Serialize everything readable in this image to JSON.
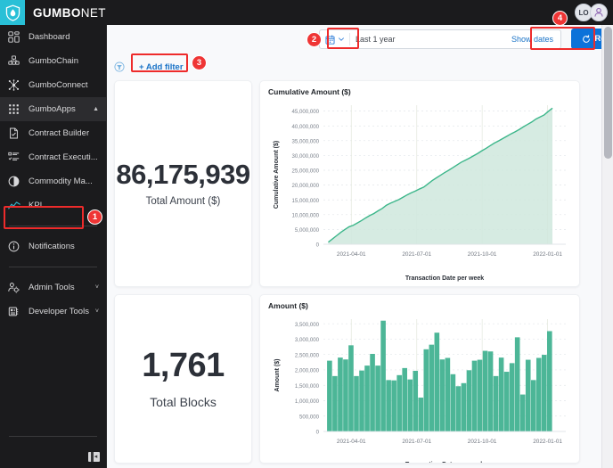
{
  "brand": {
    "bold": "GUMBO",
    "light": "NET",
    "logo_icon": "droplet-shield-logo"
  },
  "account": {
    "avatar1_initials": "LO",
    "avatar2_icon": "user-profile-icon"
  },
  "sidebar": {
    "items": [
      {
        "label": "Dashboard",
        "icon": "dashboard-grid-icon",
        "active": false,
        "chevron": ""
      },
      {
        "label": "GumboChain",
        "icon": "chain-blocks-icon",
        "active": false,
        "chevron": ""
      },
      {
        "label": "GumboConnect",
        "icon": "network-nodes-icon",
        "active": false,
        "chevron": ""
      },
      {
        "label": "GumboApps",
        "icon": "apps-dots-icon",
        "active": true,
        "chevron": "▲"
      },
      {
        "label": "Contract Builder",
        "icon": "document-check-icon",
        "active": false,
        "chevron": ""
      },
      {
        "label": "Contract Executi...",
        "icon": "checklist-icon",
        "active": false,
        "chevron": ""
      },
      {
        "label": "Commodity Ma...",
        "icon": "contrast-circle-icon",
        "active": false,
        "chevron": ""
      },
      {
        "label": "KPI",
        "icon": "trend-line-icon",
        "active": false,
        "chevron": ""
      }
    ],
    "items_after_sep": [
      {
        "label": "Notifications",
        "icon": "info-circle-icon",
        "chevron": ""
      }
    ],
    "items_footer": [
      {
        "label": "Admin Tools",
        "icon": "admin-gear-user-icon",
        "chevron": "˅"
      },
      {
        "label": "Developer Tools",
        "icon": "developer-chip-icon",
        "chevron": "˅"
      }
    ],
    "collapse_button": "collapse-sidebar-icon"
  },
  "toolbar": {
    "calendar_icon": "calendar-icon",
    "dropdown_icon": "chevron-down-icon",
    "date_range_value": "Last 1 year",
    "date_range_placeholder": "Last 1 year",
    "show_dates_label": "Show dates",
    "refresh_label": "Refresh",
    "refresh_icon": "refresh-icon",
    "refresh_color": "#0b72d9"
  },
  "filters": {
    "filter_icon": "funnel-icon",
    "add_filter_label": "+ Add filter"
  },
  "kpis": [
    {
      "value": "86,175,939",
      "label": "Total Amount ($)"
    },
    {
      "value": "1,761",
      "label": "Total Blocks"
    }
  ],
  "annotations": [
    {
      "number": "1",
      "target": "sidebar-item-kpi"
    },
    {
      "number": "2",
      "target": "date-range-picker"
    },
    {
      "number": "3",
      "target": "add-filter-button"
    },
    {
      "number": "4",
      "target": "refresh-button"
    }
  ],
  "chart_data": [
    {
      "type": "area",
      "title": "Cumulative Amount ($)",
      "xlabel": "Transaction Date per week",
      "ylabel": "Cumulative Amount ($)",
      "color": "#3cb68a",
      "fill": "#cfe8dd",
      "ylim": [
        0,
        47000000
      ],
      "yticks": [
        0,
        5000000,
        10000000,
        15000000,
        20000000,
        25000000,
        30000000,
        35000000,
        40000000,
        45000000
      ],
      "ytick_labels": [
        "0",
        "5,000,000",
        "10,000,000",
        "15,000,000",
        "20,000,000",
        "25,000,000",
        "30,000,000",
        "35,000,000",
        "40,000,000",
        "45,000,000"
      ],
      "xtick_labels": [
        "2021-04-01",
        "2021-07-01",
        "2021-10-01",
        "2022-01-01"
      ],
      "xtick_positions": [
        0.115,
        0.385,
        0.655,
        0.925
      ],
      "grid": true,
      "legend": "none",
      "values": [
        700000,
        1800000,
        2900000,
        4000000,
        5000000,
        5900000,
        6400000,
        7200000,
        8000000,
        8900000,
        9700000,
        10400000,
        11300000,
        12100000,
        13200000,
        13900000,
        14500000,
        15100000,
        15900000,
        16700000,
        17400000,
        18000000,
        18700000,
        19300000,
        20400000,
        21500000,
        22400000,
        23300000,
        24200000,
        25000000,
        25900000,
        26800000,
        27700000,
        28400000,
        29100000,
        29900000,
        30700000,
        31600000,
        32400000,
        33300000,
        34200000,
        34900000,
        35700000,
        36500000,
        37300000,
        38000000,
        38800000,
        39700000,
        40500000,
        41300000,
        42300000,
        43000000,
        43700000,
        44900000,
        46000000
      ]
    },
    {
      "type": "bar",
      "title": "Amount ($)",
      "xlabel": "Transaction Date per week",
      "ylabel": "Amount ($)",
      "color": "#4cb697",
      "ylim": [
        0,
        3650000
      ],
      "yticks": [
        0,
        500000,
        1000000,
        1500000,
        2000000,
        2500000,
        3000000,
        3500000
      ],
      "ytick_labels": [
        "0",
        "500,000",
        "1,000,000",
        "1,500,000",
        "2,000,000",
        "2,500,000",
        "3,000,000",
        "3,500,000"
      ],
      "xtick_labels": [
        "2021-04-01",
        "2021-07-01",
        "2021-10-01",
        "2022-01-01"
      ],
      "xtick_positions": [
        0.115,
        0.385,
        0.655,
        0.925
      ],
      "grid": true,
      "legend": "none",
      "values": [
        2300000,
        1800000,
        2400000,
        2340000,
        2800000,
        1800000,
        1980000,
        2140000,
        2520000,
        2140000,
        3600000,
        1670000,
        1660000,
        1830000,
        2060000,
        1690000,
        1970000,
        1100000,
        2670000,
        2820000,
        3210000,
        2340000,
        2390000,
        1860000,
        1470000,
        1570000,
        1990000,
        2300000,
        2330000,
        2620000,
        2600000,
        1800000,
        2400000,
        1940000,
        2220000,
        3060000,
        1200000,
        2330000,
        1670000,
        2390000,
        2490000,
        3260000
      ]
    }
  ]
}
